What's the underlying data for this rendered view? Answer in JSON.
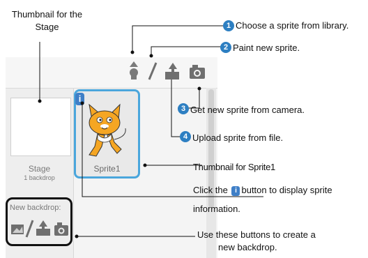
{
  "annotations": {
    "thumbnail_stage": "Thumbnail for the Stage",
    "n1": "1",
    "n2": "2",
    "n3": "3",
    "n4": "4",
    "choose_sprite": "Choose a sprite from  library.",
    "paint_sprite": "Paint new sprite.",
    "camera_sprite": "Get new sprite from  camera.",
    "upload_sprite": "Upload sprite from file.",
    "thumbnail_sprite": "Thumbnail for Sprite1",
    "click_info_pre": "Click the",
    "click_info_post": "button to  display sprite",
    "click_info_line2": "information.",
    "backdrop_buttons_line1": "Use these buttons to create a",
    "backdrop_buttons_line2": "new backdrop."
  },
  "stage": {
    "label": "Stage",
    "sub": "1 backdrop",
    "new_backdrop": "New backdrop:"
  },
  "sprite": {
    "name": "Sprite1",
    "info_glyph": "i"
  },
  "icons": [
    "sprite-library-icon",
    "paint-icon",
    "upload-icon",
    "camera-icon",
    "scratch-cat-icon"
  ],
  "colors": {
    "accent": "#2d7fc2",
    "selection": "#4aa6dc"
  }
}
